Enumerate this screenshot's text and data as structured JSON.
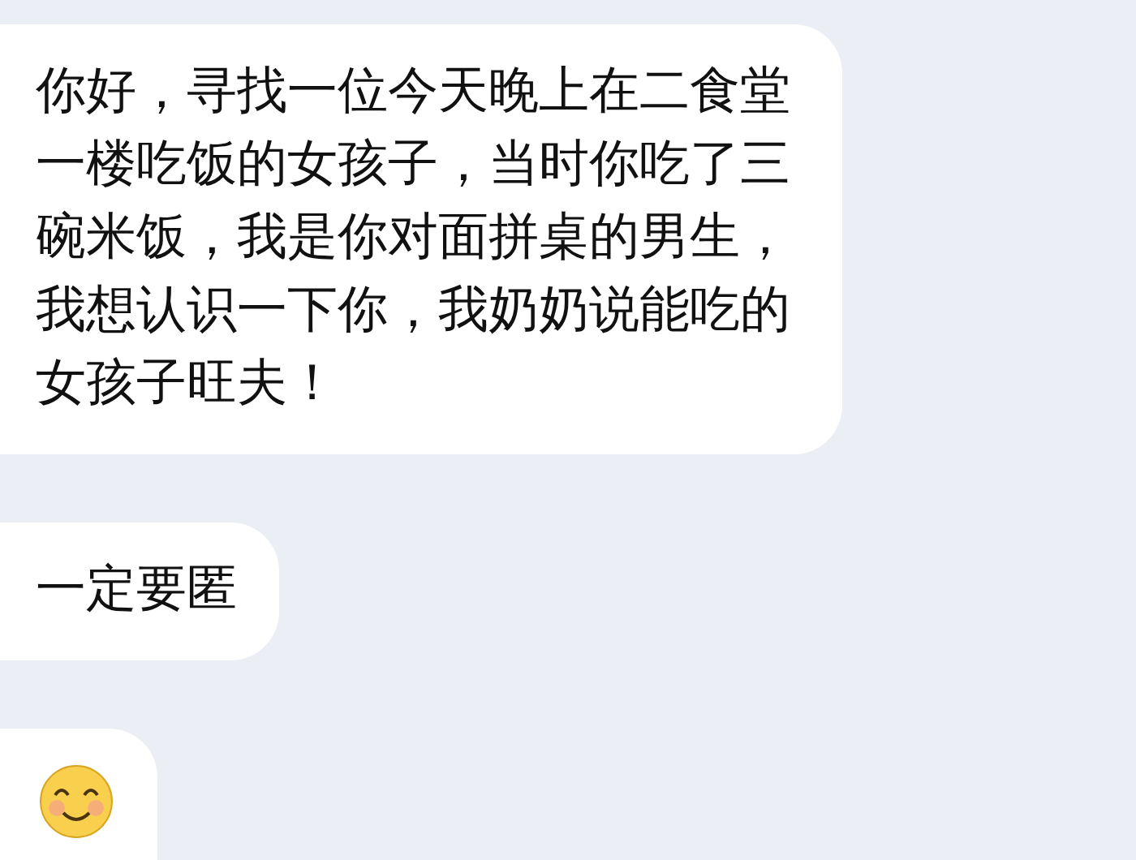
{
  "messages": [
    {
      "kind": "text",
      "text": "你好，寻找一位今天晚上在二食堂一楼吃饭的女孩子，当时你吃了三碗米饭，我是你对面拼桌的男生，我想认识一下你，我奶奶说能吃的女孩子旺夫！"
    },
    {
      "kind": "text",
      "text": "一定要匿"
    },
    {
      "kind": "emoji"
    }
  ]
}
